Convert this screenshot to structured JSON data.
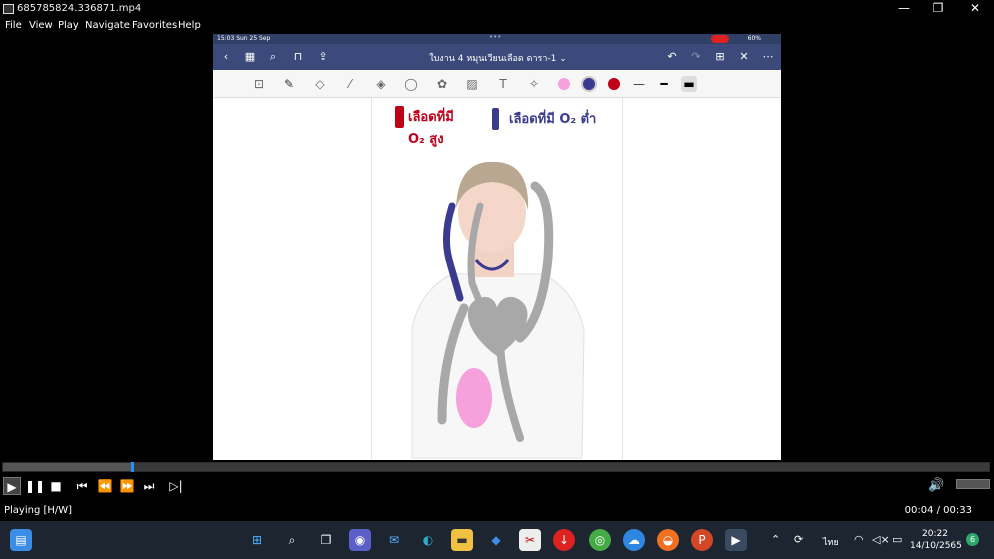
{
  "window": {
    "title": "685785824.336871.mp4",
    "minimize": "—",
    "restore": "❐",
    "close": "✕"
  },
  "menu": {
    "items": [
      "File",
      "View",
      "Play",
      "Navigate",
      "Favorites",
      "Help"
    ]
  },
  "ipad": {
    "status_left": "15:03   Sun 25 Sep",
    "status_right": "60%",
    "doc_title": "ใบงาน 4 หมุนเวียนเลือด ดารา-1 ⌄",
    "note_red_line1": "เลือดที่มี",
    "note_red_line2": "O₂ สูง",
    "note_blue": "เลือดที่มี O₂ ต่ำ",
    "colors": {
      "red": "#c00018",
      "blue": "#3a3a90",
      "pink": "#f6a0dc",
      "gray": "#a8a8a8",
      "nav": "#3b4a7a"
    }
  },
  "player": {
    "progress_fraction": 0.13,
    "status": "Playing [H/W]",
    "time": "00:04 / 00:33"
  },
  "taskbar": {
    "lang": "ไทย",
    "time": "20:22",
    "date": "14/10/2565",
    "notifications": "6"
  }
}
